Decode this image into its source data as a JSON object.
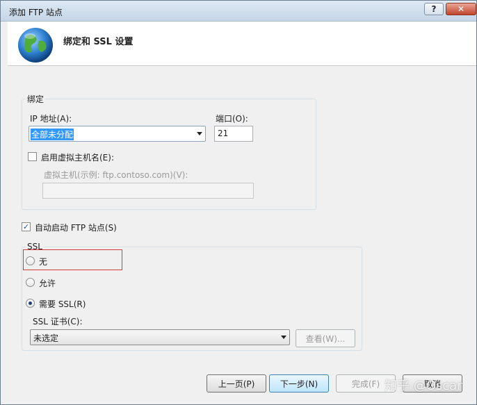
{
  "window": {
    "title": "添加 FTP 站点",
    "help_glyph": "?",
    "close_glyph": "✕"
  },
  "header": {
    "title": "绑定和 SSL 设置",
    "icon": "globe-icon"
  },
  "binding": {
    "group_label": "绑定",
    "ip_label": "IP 地址(A):",
    "ip_value": "全部未分配",
    "port_label": "端口(O):",
    "port_value": "21",
    "virtual_host_checkbox_label": "启用虚拟主机名(E):",
    "virtual_host_checked": false,
    "virtual_host_field_label": "虚拟主机(示例: ftp.contoso.com)(V):",
    "virtual_host_value": ""
  },
  "auto_start": {
    "label": "自动启动 FTP 站点(S)",
    "checked": true
  },
  "ssl": {
    "group_label": "SSL",
    "options": [
      {
        "label": "无",
        "checked": false
      },
      {
        "label": "允许",
        "checked": false
      },
      {
        "label": "需要 SSL(R)",
        "checked": true
      }
    ],
    "cert_label": "SSL 证书(C):",
    "cert_value": "未选定",
    "view_button": "查看(W)..."
  },
  "buttons": {
    "previous": "上一页(P)",
    "next": "下一步(N)",
    "finish": "完成(F)",
    "cancel": "取消"
  },
  "watermark": "知乎 @Oscar",
  "colors": {
    "highlight": "#d33b3b",
    "selection": "#3399ff"
  }
}
